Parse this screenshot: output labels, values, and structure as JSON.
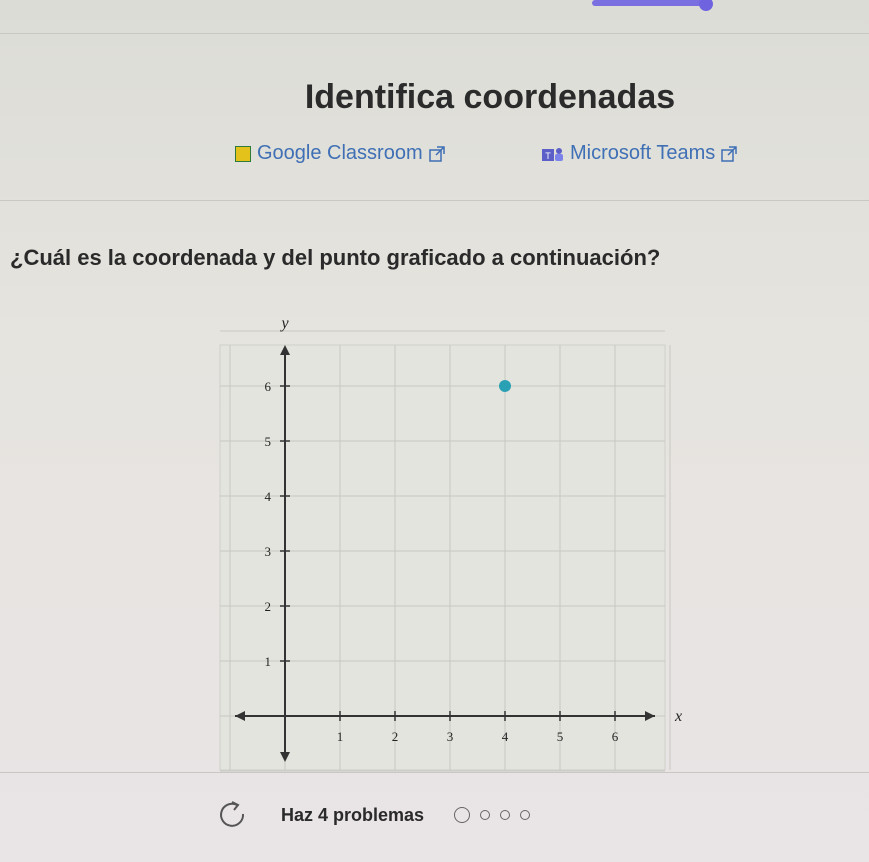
{
  "page": {
    "title": "Identifica coordenadas",
    "progress_fraction": 0.82
  },
  "share": {
    "google_classroom": "Google Classroom",
    "microsoft_teams": "Microsoft Teams"
  },
  "question": "¿Cuál es la coordenada y del punto graficado a continuación?",
  "chart_data": {
    "type": "scatter",
    "xlabel": "x",
    "ylabel": "y",
    "x_ticks": [
      "1",
      "2",
      "3",
      "4",
      "5",
      "6"
    ],
    "y_ticks": [
      "1",
      "2",
      "3",
      "4",
      "5",
      "6"
    ],
    "xlim": [
      -1,
      7
    ],
    "ylim": [
      0,
      7
    ],
    "grid": true,
    "points": [
      {
        "x": 4,
        "y": 6
      }
    ],
    "point_color": "#2aa0b4"
  },
  "footer": {
    "label": "Haz 4 problemas",
    "problem_count": 4,
    "icon": "retry-icon"
  }
}
